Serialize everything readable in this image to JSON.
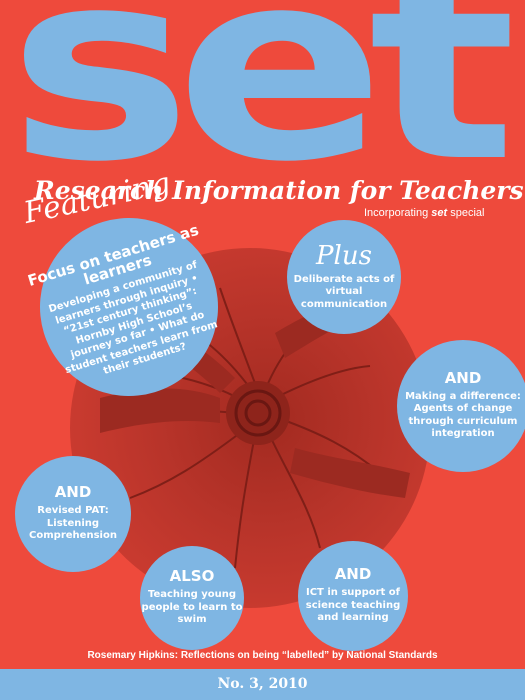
{
  "masthead": "set",
  "subtitle": "Research Information for Teachers",
  "incorporating": {
    "prefix": "Incorporating",
    "brand": "set",
    "suffix": "special"
  },
  "featuring_label": "Featuring",
  "bubbles": {
    "focus": {
      "head": "Focus on teachers as learners",
      "body": "Developing a community of learners through inquiry • “21st century thinking”: Hornby High School’s journey so far • What do student teachers learn from their students?"
    },
    "plus": {
      "head": "Plus",
      "body": "Deliberate acts of virtual communication"
    },
    "making": {
      "head": "AND",
      "body": "Making a difference: Agents of change through curriculum integration"
    },
    "revised": {
      "head": "AND",
      "body": "Revised PAT: Listening Comprehension"
    },
    "also": {
      "head": "ALSO",
      "body": "Teaching young people to learn to swim"
    },
    "ict": {
      "head": "AND",
      "body": "ICT in support of science teaching and learning"
    }
  },
  "bottom_line": "Rosemary Hipkins: Reflections on being “labelled” by National Standards",
  "issue": "No. 3, 2010",
  "colors": {
    "background": "#ee4a3c",
    "accent": "#7fb6e3",
    "photo": "#b8342a"
  }
}
